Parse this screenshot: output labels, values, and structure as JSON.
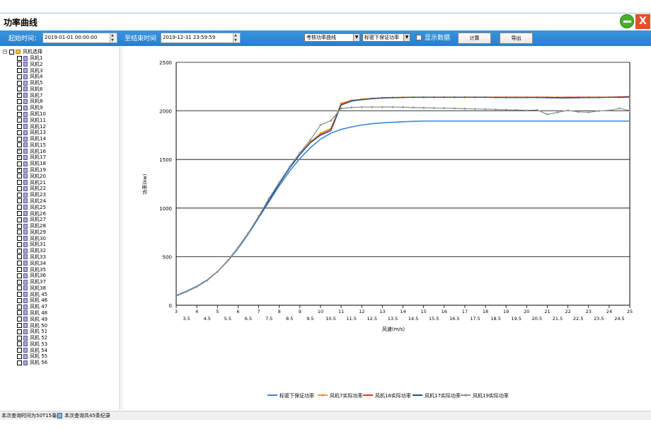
{
  "window": {
    "title": "功率曲线"
  },
  "toolbar": {
    "start_label": "起始时间：",
    "start_value": "2019-01-01 00:00:00",
    "end_label": "至结束时间",
    "end_value": "2019-12-31 23:59:59",
    "curve_select": "考核功率曲线",
    "density_select": "标密下保证功率",
    "show_data_label": "显示数据",
    "calc_button": "计算",
    "export_button": "导出"
  },
  "tree": {
    "root_label": "风机选择",
    "items": [
      {
        "label": "风机1",
        "checked": false
      },
      {
        "label": "风机2",
        "checked": false
      },
      {
        "label": "风机3",
        "checked": false
      },
      {
        "label": "风机4",
        "checked": false
      },
      {
        "label": "风机5",
        "checked": false
      },
      {
        "label": "风机6",
        "checked": false
      },
      {
        "label": "风机7",
        "checked": true
      },
      {
        "label": "风机8",
        "checked": false
      },
      {
        "label": "风机9",
        "checked": false
      },
      {
        "label": "风机10",
        "checked": false
      },
      {
        "label": "风机11",
        "checked": false
      },
      {
        "label": "风机12",
        "checked": false
      },
      {
        "label": "风机13",
        "checked": false
      },
      {
        "label": "风机14",
        "checked": false
      },
      {
        "label": "风机15",
        "checked": false
      },
      {
        "label": "风机16",
        "checked": true
      },
      {
        "label": "风机17",
        "checked": true
      },
      {
        "label": "风机18",
        "checked": false
      },
      {
        "label": "风机19",
        "checked": true
      },
      {
        "label": "风机20",
        "checked": false
      },
      {
        "label": "风机21",
        "checked": false
      },
      {
        "label": "风机22",
        "checked": false
      },
      {
        "label": "风机23",
        "checked": false
      },
      {
        "label": "风机24",
        "checked": false
      },
      {
        "label": "风机25",
        "checked": false
      },
      {
        "label": "风机26",
        "checked": false
      },
      {
        "label": "风机27",
        "checked": false
      },
      {
        "label": "风机28",
        "checked": false
      },
      {
        "label": "风机29",
        "checked": false
      },
      {
        "label": "风机30",
        "checked": false
      },
      {
        "label": "风机31",
        "checked": false
      },
      {
        "label": "风机32",
        "checked": false
      },
      {
        "label": "风机33",
        "checked": false
      },
      {
        "label": "风机34",
        "checked": false
      },
      {
        "label": "风机35",
        "checked": false
      },
      {
        "label": "风机36",
        "checked": false
      },
      {
        "label": "风机37",
        "checked": false
      },
      {
        "label": "风机38",
        "checked": false
      },
      {
        "label": "风机 45",
        "checked": false
      },
      {
        "label": "风机 46",
        "checked": false
      },
      {
        "label": "风机 47",
        "checked": false
      },
      {
        "label": "风机 48",
        "checked": false
      },
      {
        "label": "风机 49",
        "checked": false
      },
      {
        "label": "风机 50",
        "checked": false
      },
      {
        "label": "风机 51",
        "checked": false
      },
      {
        "label": "风机 52",
        "checked": false
      },
      {
        "label": "风机 53",
        "checked": false
      },
      {
        "label": "风机 54",
        "checked": false
      },
      {
        "label": "风机 55",
        "checked": false
      },
      {
        "label": "风机 56",
        "checked": false
      }
    ]
  },
  "status": {
    "left": "本次查询时间为50T15毫秒",
    "right": "本次查询共45条纪录"
  },
  "chart_data": {
    "type": "line",
    "title": "",
    "xlabel": "风速(m/s)",
    "ylabel": "功率(kw)",
    "xlim": [
      3,
      25
    ],
    "ylim": [
      0,
      2500
    ],
    "y_ticks": [
      0,
      500,
      1000,
      1500,
      2000,
      2500
    ],
    "x_ticks_top": [
      "3",
      "4",
      "5",
      "6",
      "7",
      "8",
      "9",
      "10",
      "11",
      "12",
      "13",
      "14",
      "15",
      "16",
      "17",
      "18",
      "19",
      "20",
      "21",
      "22",
      "23",
      "24",
      "25"
    ],
    "x_ticks_bottom": [
      "3.5",
      "4.5",
      "5.5",
      "6.5",
      "7.5",
      "8.5",
      "9.5",
      "10.5",
      "11.5",
      "12.5",
      "13.5",
      "14.5",
      "15.5",
      "16.5",
      "17.5",
      "18.5",
      "19.5",
      "20.5",
      "21.5",
      "22.5",
      "23.5",
      "24.5"
    ],
    "grid": "horizontal",
    "legend_position": "bottom",
    "x": [
      3,
      3.5,
      4,
      4.5,
      5,
      5.5,
      6,
      6.5,
      7,
      7.5,
      8,
      8.5,
      9,
      9.5,
      10,
      10.5,
      11,
      11.5,
      12,
      12.5,
      13,
      13.5,
      14,
      14.5,
      15,
      15.5,
      16,
      16.5,
      17,
      17.5,
      18,
      18.5,
      19,
      19.5,
      20,
      20.5,
      21,
      21.5,
      22,
      22.5,
      23,
      23.5,
      24,
      24.5,
      25
    ],
    "series": [
      {
        "name": "标密下保证功率",
        "color": "#3a87d6",
        "marker": "none",
        "values": [
          100,
          145,
          195,
          260,
          345,
          455,
          585,
          735,
          900,
          1065,
          1230,
          1380,
          1510,
          1620,
          1710,
          1770,
          1810,
          1835,
          1855,
          1868,
          1877,
          1883,
          1888,
          1893,
          1895,
          1895,
          1895,
          1895,
          1895,
          1895,
          1895,
          1895,
          1895,
          1895,
          1895,
          1895,
          1895,
          1895,
          1895,
          1895,
          1895,
          1895,
          1895,
          1895,
          1895
        ]
      },
      {
        "name": "风机7实际功率",
        "color": "#f0a21f",
        "marker": "dot",
        "values": [
          95,
          140,
          190,
          255,
          345,
          460,
          595,
          745,
          915,
          1095,
          1260,
          1420,
          1560,
          1680,
          1770,
          1820,
          2080,
          2110,
          2120,
          2130,
          2135,
          2138,
          2140,
          2140,
          2140,
          2140,
          2140,
          2140,
          2140,
          2140,
          2140,
          2140,
          2140,
          2140,
          2140,
          2140,
          2140,
          2140,
          2140,
          2140,
          2140,
          2140,
          2140,
          2140,
          2140
        ]
      },
      {
        "name": "风机16实际功率",
        "color": "#d8421f",
        "marker": "none",
        "values": [
          95,
          140,
          190,
          255,
          345,
          460,
          595,
          745,
          910,
          1085,
          1255,
          1415,
          1555,
          1675,
          1760,
          1810,
          2070,
          2105,
          2120,
          2128,
          2135,
          2138,
          2140,
          2141,
          2142,
          2142,
          2142,
          2142,
          2142,
          2142,
          2142,
          2142,
          2142,
          2142,
          2142,
          2142,
          2142,
          2140,
          2142,
          2142,
          2142,
          2142,
          2142,
          2145,
          2148
        ]
      },
      {
        "name": "风机17实际功率",
        "color": "#1f4f8a",
        "marker": "none",
        "values": [
          95,
          140,
          190,
          255,
          345,
          460,
          590,
          740,
          905,
          1080,
          1250,
          1410,
          1550,
          1670,
          1750,
          1795,
          2060,
          2100,
          2115,
          2125,
          2132,
          2136,
          2138,
          2140,
          2140,
          2140,
          2140,
          2140,
          2140,
          2140,
          2140,
          2138,
          2138,
          2138,
          2138,
          2138,
          2135,
          2133,
          2133,
          2135,
          2138,
          2138,
          2140,
          2140,
          2142
        ]
      },
      {
        "name": "风机19实际功率",
        "color": "#8a9599",
        "marker": "dot",
        "values": [
          95,
          140,
          190,
          255,
          345,
          460,
          595,
          745,
          915,
          1100,
          1265,
          1425,
          1570,
          1700,
          1855,
          1900,
          2025,
          2035,
          2040,
          2040,
          2040,
          2040,
          2038,
          2035,
          2032,
          2030,
          2028,
          2025,
          2022,
          2020,
          2018,
          2015,
          2012,
          2010,
          2005,
          2010,
          1965,
          1985,
          2005,
          1990,
          1985,
          2000,
          2005,
          2025,
          2005
        ]
      }
    ]
  }
}
